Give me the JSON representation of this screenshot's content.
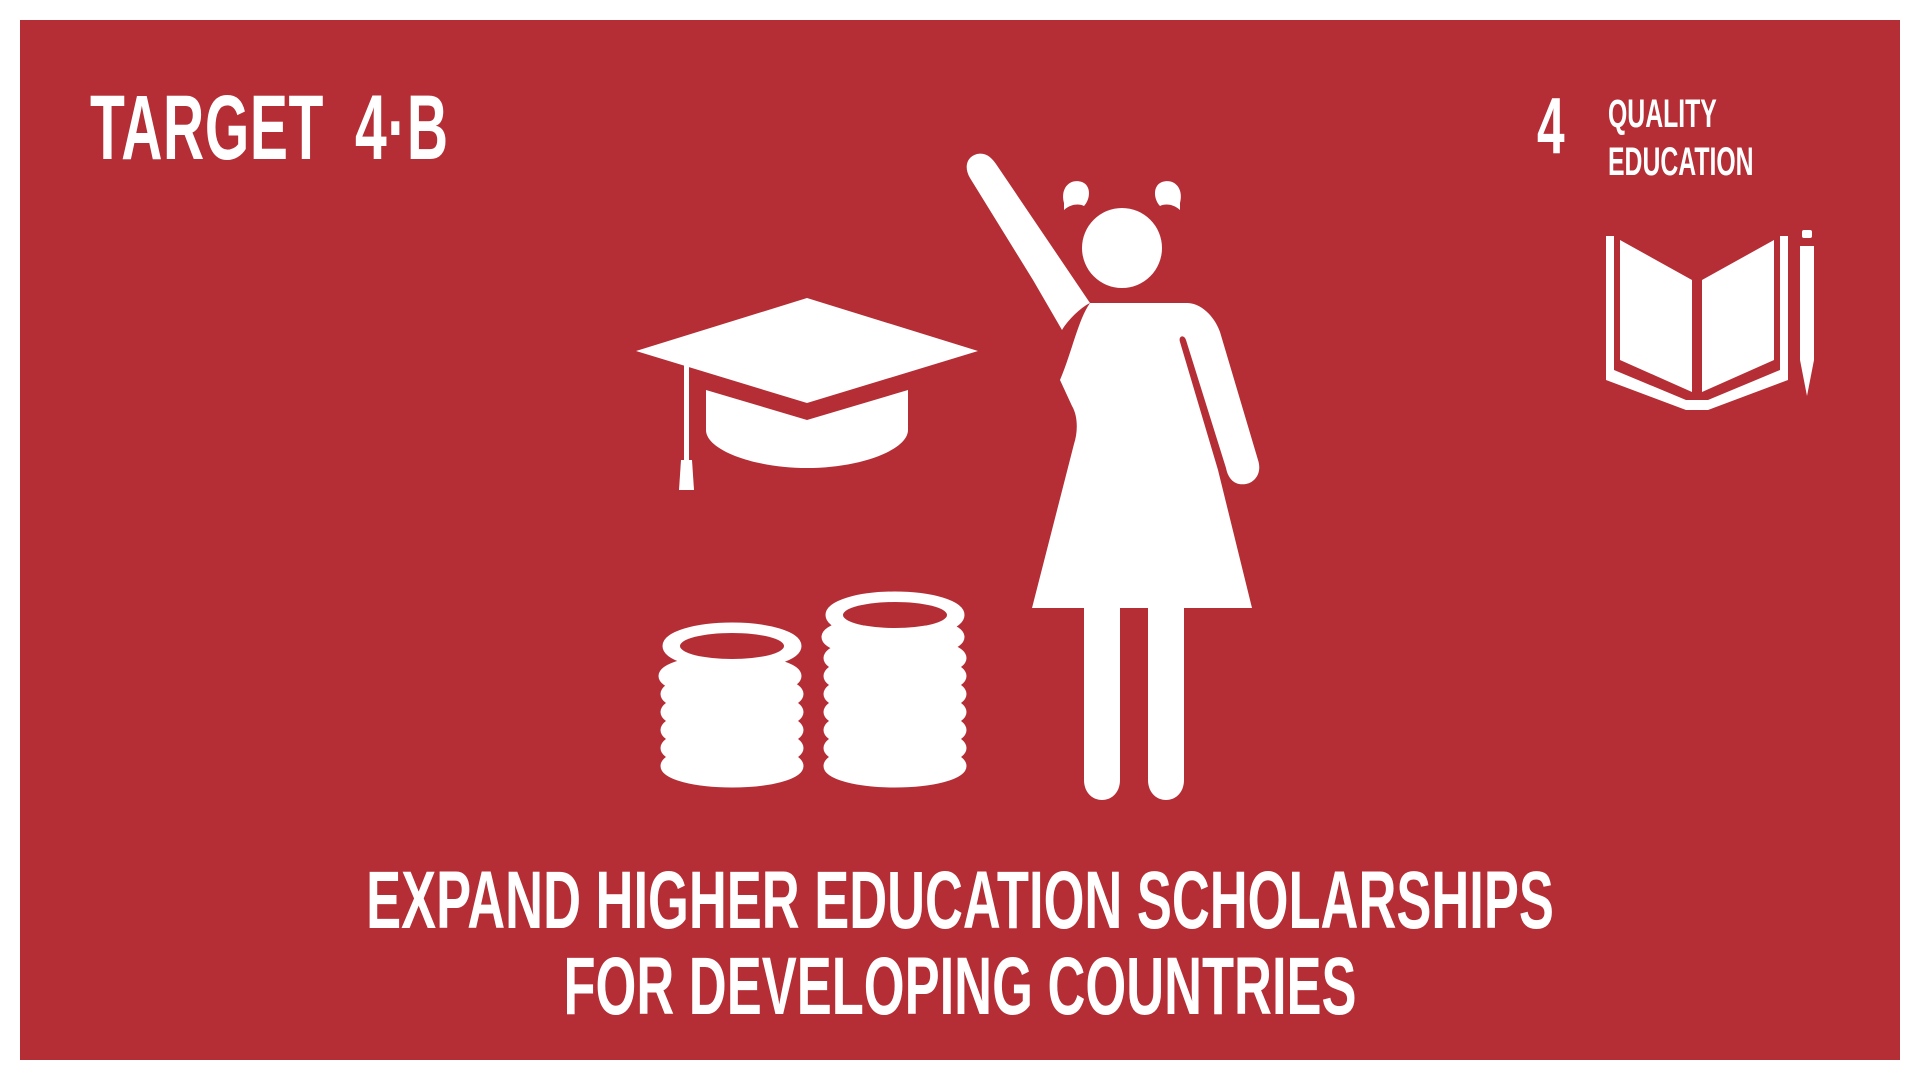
{
  "header": {
    "target_word": "TARGET",
    "target_number": "4·B"
  },
  "goal": {
    "number": "4",
    "name_line1": "QUALITY",
    "name_line2": "EDUCATION",
    "icon": "open-book-pencil-icon"
  },
  "illustration": {
    "icons": [
      "graduation-cap-icon",
      "coin-stack-icon",
      "coin-stack-icon",
      "girl-raising-hand-icon"
    ]
  },
  "target_text": {
    "line1": "EXPAND HIGHER EDUCATION SCHOLARSHIPS",
    "line2": "FOR DEVELOPING COUNTRIES"
  },
  "colors": {
    "background": "#b52e35",
    "foreground": "#ffffff",
    "frame": "#ffffff"
  }
}
